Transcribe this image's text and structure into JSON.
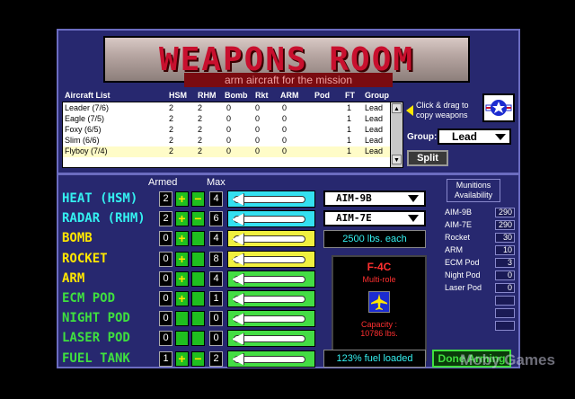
{
  "title": "WEAPONS ROOM",
  "subtitle": "arm aircraft for the mission",
  "aircraft_list": {
    "headers": {
      "name": "Aircraft List",
      "hsm": "HSM",
      "rhm": "RHM",
      "bomb": "Bomb",
      "rkt": "Rkt",
      "arm": "ARM",
      "pod": "Pod",
      "ft": "FT",
      "group": "Group"
    },
    "rows": [
      {
        "name": "Leader  (7/6)",
        "hsm": "2",
        "rhm": "2",
        "bomb": "0",
        "rkt": "0",
        "arm": "0",
        "pod": "",
        "ft": "1",
        "group": "Lead"
      },
      {
        "name": "Eagle  (7/5)",
        "hsm": "2",
        "rhm": "2",
        "bomb": "0",
        "rkt": "0",
        "arm": "0",
        "pod": "",
        "ft": "1",
        "group": "Lead"
      },
      {
        "name": "Foxy  (6/5)",
        "hsm": "2",
        "rhm": "2",
        "bomb": "0",
        "rkt": "0",
        "arm": "0",
        "pod": "",
        "ft": "1",
        "group": "Lead"
      },
      {
        "name": "Slim  (6/6)",
        "hsm": "2",
        "rhm": "2",
        "bomb": "0",
        "rkt": "0",
        "arm": "0",
        "pod": "",
        "ft": "1",
        "group": "Lead"
      },
      {
        "name": "Flyboy  (7/4)",
        "hsm": "2",
        "rhm": "2",
        "bomb": "0",
        "rkt": "0",
        "arm": "0",
        "pod": "",
        "ft": "1",
        "group": "Lead"
      }
    ]
  },
  "hint": "Click & drag to copy weapons",
  "group": {
    "label": "Group:",
    "value": "Lead"
  },
  "split_label": "Split",
  "columns": {
    "armed": "Armed",
    "max": "Max"
  },
  "weapons": [
    {
      "name": "HEAT (HSM)",
      "armed": "2",
      "max": "4",
      "color": "#34f0f0",
      "slot_color": "#34e0f0",
      "plus": "+",
      "minus": "−"
    },
    {
      "name": "RADAR (RHM)",
      "armed": "2",
      "max": "6",
      "color": "#34f0f0",
      "slot_color": "#34e0f0",
      "plus": "+",
      "minus": "−"
    },
    {
      "name": "BOMB",
      "armed": "0",
      "max": "4",
      "color": "#ffe600",
      "slot_color": "#f0f040",
      "plus": "+",
      "minus": ""
    },
    {
      "name": "ROCKET",
      "armed": "0",
      "max": "8",
      "color": "#ffe600",
      "slot_color": "#f0f040",
      "plus": "+",
      "minus": ""
    },
    {
      "name": "ARM",
      "armed": "0",
      "max": "4",
      "color": "#ffe600",
      "slot_color": "#44dd44",
      "plus": "+",
      "minus": ""
    },
    {
      "name": "ECM POD",
      "armed": "0",
      "max": "1",
      "color": "#3fdf3f",
      "slot_color": "#44dd44",
      "plus": "+",
      "minus": ""
    },
    {
      "name": "NIGHT POD",
      "armed": "0",
      "max": "0",
      "color": "#3fdf3f",
      "slot_color": "#44dd44",
      "plus": "",
      "minus": ""
    },
    {
      "name": "LASER POD",
      "armed": "0",
      "max": "0",
      "color": "#3fdf3f",
      "slot_color": "#44dd44",
      "plus": "",
      "minus": ""
    },
    {
      "name": "FUEL TANK",
      "armed": "1",
      "max": "2",
      "color": "#3fdf3f",
      "slot_color": "#44dd44",
      "plus": "+",
      "minus": "−"
    }
  ],
  "selectors": {
    "hsm": "AIM-9B",
    "rhm": "AIM-7E"
  },
  "bomb_info": "2500 lbs. each",
  "fuel_info": "123% fuel loaded",
  "aircraft": {
    "name": "F-4C",
    "role": "Multi-role",
    "capacity_label": "Capacity :",
    "capacity": "10786 lbs."
  },
  "munitions": {
    "title": "Munitions Availability",
    "items": [
      {
        "label": "AIM-9B",
        "value": "290"
      },
      {
        "label": "AIM-7E",
        "value": "290"
      },
      {
        "label": "Rocket",
        "value": "30"
      },
      {
        "label": "ARM",
        "value": "10"
      },
      {
        "label": "ECM Pod",
        "value": "3"
      },
      {
        "label": "Night Pod",
        "value": "0"
      },
      {
        "label": "Laser Pod",
        "value": "0"
      },
      {
        "label": "",
        "value": ""
      },
      {
        "label": "",
        "value": ""
      },
      {
        "label": "",
        "value": ""
      }
    ]
  },
  "done_label": "Done Arming",
  "watermark": "Moby Games"
}
